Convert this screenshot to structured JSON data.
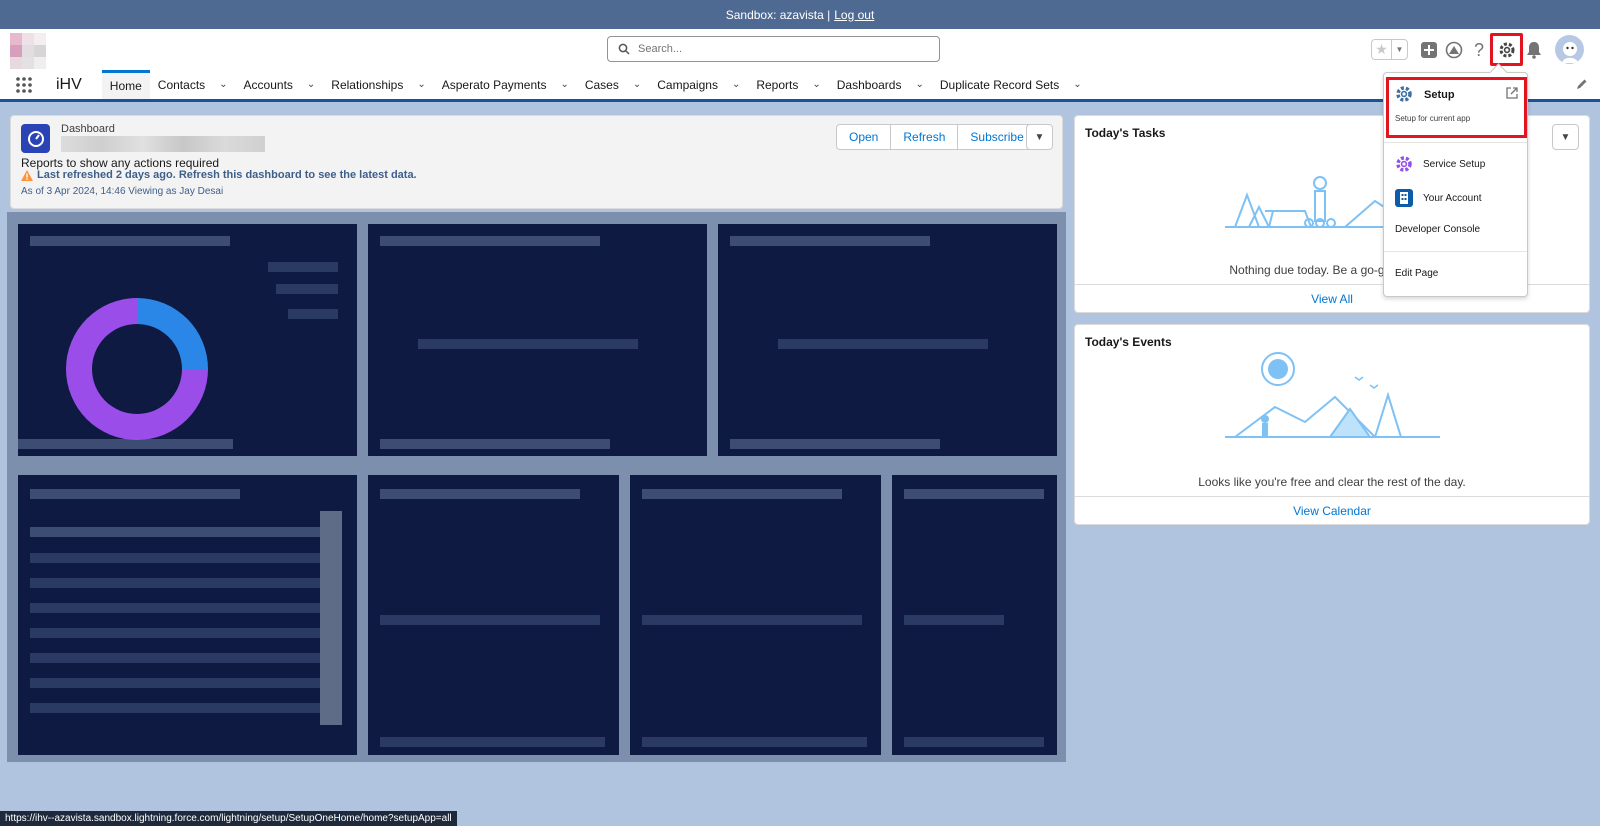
{
  "sandbox_bar": {
    "text": "Sandbox: azavista |",
    "logout": "Log out"
  },
  "header": {
    "search_placeholder": "Search...",
    "icons": [
      "favorites-star-icon",
      "add-icon",
      "trailhead-icon",
      "help-icon",
      "setup-gear-icon",
      "notifications-bell-icon",
      "avatar"
    ]
  },
  "nav": {
    "app_name": "iHV",
    "items": [
      {
        "label": "Home",
        "active": true,
        "chevron": false
      },
      {
        "label": "Contacts",
        "chevron": true
      },
      {
        "label": "Accounts",
        "chevron": true
      },
      {
        "label": "Relationships",
        "chevron": true
      },
      {
        "label": "Asperato Payments",
        "chevron": true
      },
      {
        "label": "Cases",
        "chevron": true
      },
      {
        "label": "Campaigns",
        "chevron": true
      },
      {
        "label": "Reports",
        "chevron": true
      },
      {
        "label": "Dashboards",
        "chevron": true
      },
      {
        "label": "Duplicate Record Sets",
        "chevron": true
      }
    ]
  },
  "dashboard": {
    "label": "Dashboard",
    "reports_text": "Reports to show any actions required",
    "warning": "Last refreshed 2 days ago. Refresh this dashboard to see the latest data.",
    "as_of": "As of 3 Apr 2024, 14:46 Viewing as Jay Desai",
    "buttons": {
      "open": "Open",
      "refresh": "Refresh",
      "subscribe": "Subscribe"
    }
  },
  "tasks_card": {
    "title": "Today's Tasks",
    "message": "Nothing due today. Be a go-getter, and",
    "footer": "View All"
  },
  "events_card": {
    "title": "Today's Events",
    "message": "Looks like you're free and clear the rest of the day.",
    "footer": "View Calendar"
  },
  "setup_menu": {
    "setup_title": "Setup",
    "setup_sub": "Setup for current app",
    "service_setup": "Service Setup",
    "your_account": "Your Account",
    "developer_console": "Developer Console",
    "edit_page": "Edit Page"
  },
  "status_url": "https://ihv--azavista.sandbox.lightning.force.com/lightning/setup/SetupOneHome/home?setupApp=all",
  "colors": {
    "brand": "#0176d3",
    "highlight": "#e2141f",
    "banner": "#4f6a92",
    "panel": "#0e1a41"
  }
}
